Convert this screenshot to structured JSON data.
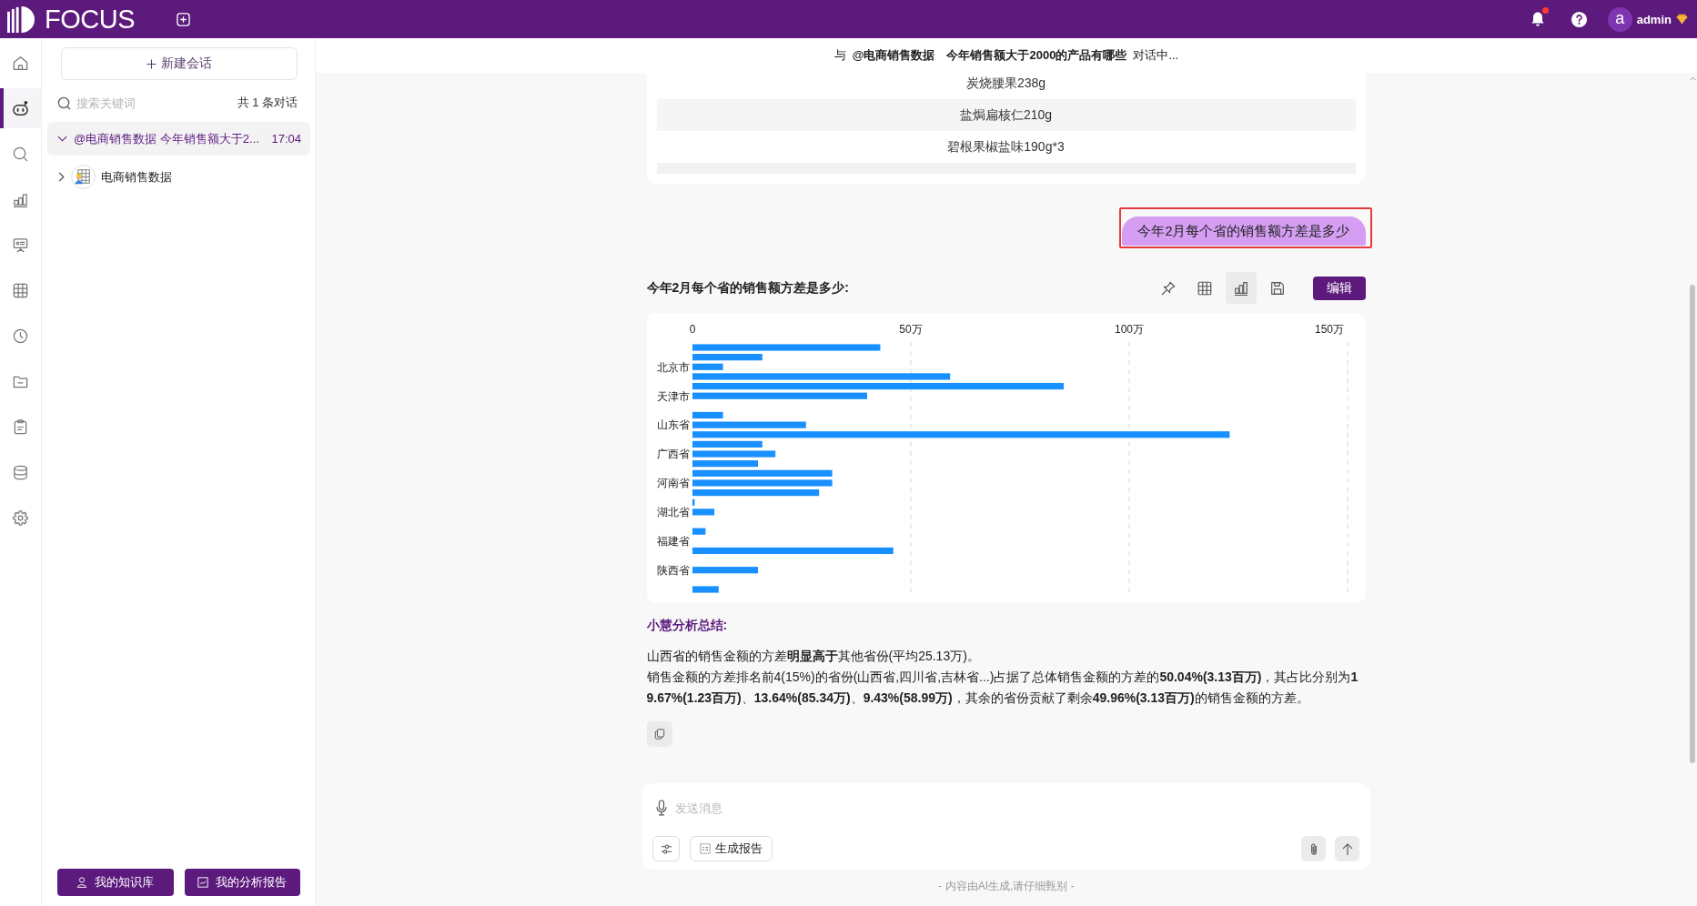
{
  "topbar": {
    "logo": "FOCUS",
    "notifications_unread": true,
    "avatar_letter": "a",
    "user": "admin"
  },
  "nav": [
    {
      "kind": "home",
      "selected": false
    },
    {
      "kind": "assistant",
      "selected": true
    },
    {
      "kind": "search",
      "selected": false
    },
    {
      "kind": "chart",
      "selected": false
    },
    {
      "kind": "presentation",
      "selected": false
    },
    {
      "kind": "table",
      "selected": false
    },
    {
      "kind": "history",
      "selected": false
    },
    {
      "kind": "folder",
      "selected": false
    },
    {
      "kind": "clipboard",
      "selected": false
    },
    {
      "kind": "database",
      "selected": false
    },
    {
      "kind": "settings",
      "selected": false
    }
  ],
  "sidebar": {
    "new_chat": "新建会话",
    "search": {
      "placeholder": "搜索关键词"
    },
    "count": "共 1 条对话",
    "conversations": [
      {
        "title": "@电商销售数据 今年销售额大于2...",
        "time": "17:04",
        "selected": true,
        "expanded": true,
        "children": [
          {
            "label": "电商销售数据",
            "expanded": false
          }
        ]
      }
    ],
    "buttons": [
      {
        "kind": "knowledge",
        "label": "我的知识库"
      },
      {
        "kind": "reports",
        "label": "我的分析报告"
      }
    ]
  },
  "chat": {
    "header": {
      "prefix": "与",
      "dataset": "@电商销售数据",
      "question": "今年销售额大于2000的产品有哪些",
      "status": "对话中..."
    },
    "table_rows": [
      "炭烧腰果238g",
      "盐焗扁核仁210g",
      "碧根果椒盐味190g*3"
    ],
    "user_message": {
      "text": "今年2月每个省的销售额方差是多少",
      "highlighted": true
    },
    "answer": {
      "title": "今年2月每个省的销售额方差是多少:",
      "tools": [
        {
          "kind": "pin",
          "selected": false
        },
        {
          "kind": "table",
          "selected": false
        },
        {
          "kind": "chart",
          "selected": true
        },
        {
          "kind": "save",
          "selected": false
        }
      ],
      "edit_button": "编辑",
      "chart_data": {
        "type": "bar",
        "orientation": "horizontal",
        "grid": true,
        "categories": [
          null,
          null,
          "北京市",
          null,
          null,
          "天津市",
          null,
          null,
          "山东省",
          null,
          null,
          "广西省",
          null,
          null,
          "河南省",
          null,
          null,
          "湖北省",
          null,
          null,
          "福建省",
          null,
          null,
          "陕西省",
          null,
          null
        ],
        "values": [
          43,
          16,
          7,
          59,
          85,
          40,
          null,
          7,
          26,
          123,
          16,
          19,
          15,
          32,
          32,
          29,
          0.5,
          5,
          null,
          3,
          null,
          46,
          null,
          15,
          null,
          6
        ],
        "xlim": [
          0,
          150
        ],
        "xticks": [
          {
            "value": 0,
            "label": "0"
          },
          {
            "value": 50,
            "label": "50万"
          },
          {
            "value": 100,
            "label": "100万"
          },
          {
            "value": 150,
            "label": "150万"
          }
        ]
      },
      "summary_title": "小慧分析总结:",
      "summary": [
        "山西省的销售金额的方差**明显高于**其他省份(平均25.13万)。",
        "销售金额的方差排名前4(15%)的省份(山西省,四川省,吉林省...)占据了总体销售金额的方差的**50.04%(3.13百万)**，其占比分别为**19.67%(1.23百万)**、**13.64%(85.34万)**、**9.43%(58.99万)**，其余的省份贡献了剩余**49.96%(3.13百万)**的销售金额的方差。"
      ]
    },
    "composer": {
      "placeholder": "发送消息",
      "report_button": "生成报告"
    },
    "disclaimer": "- 内容由AI生成,请仔细甄别 -"
  }
}
